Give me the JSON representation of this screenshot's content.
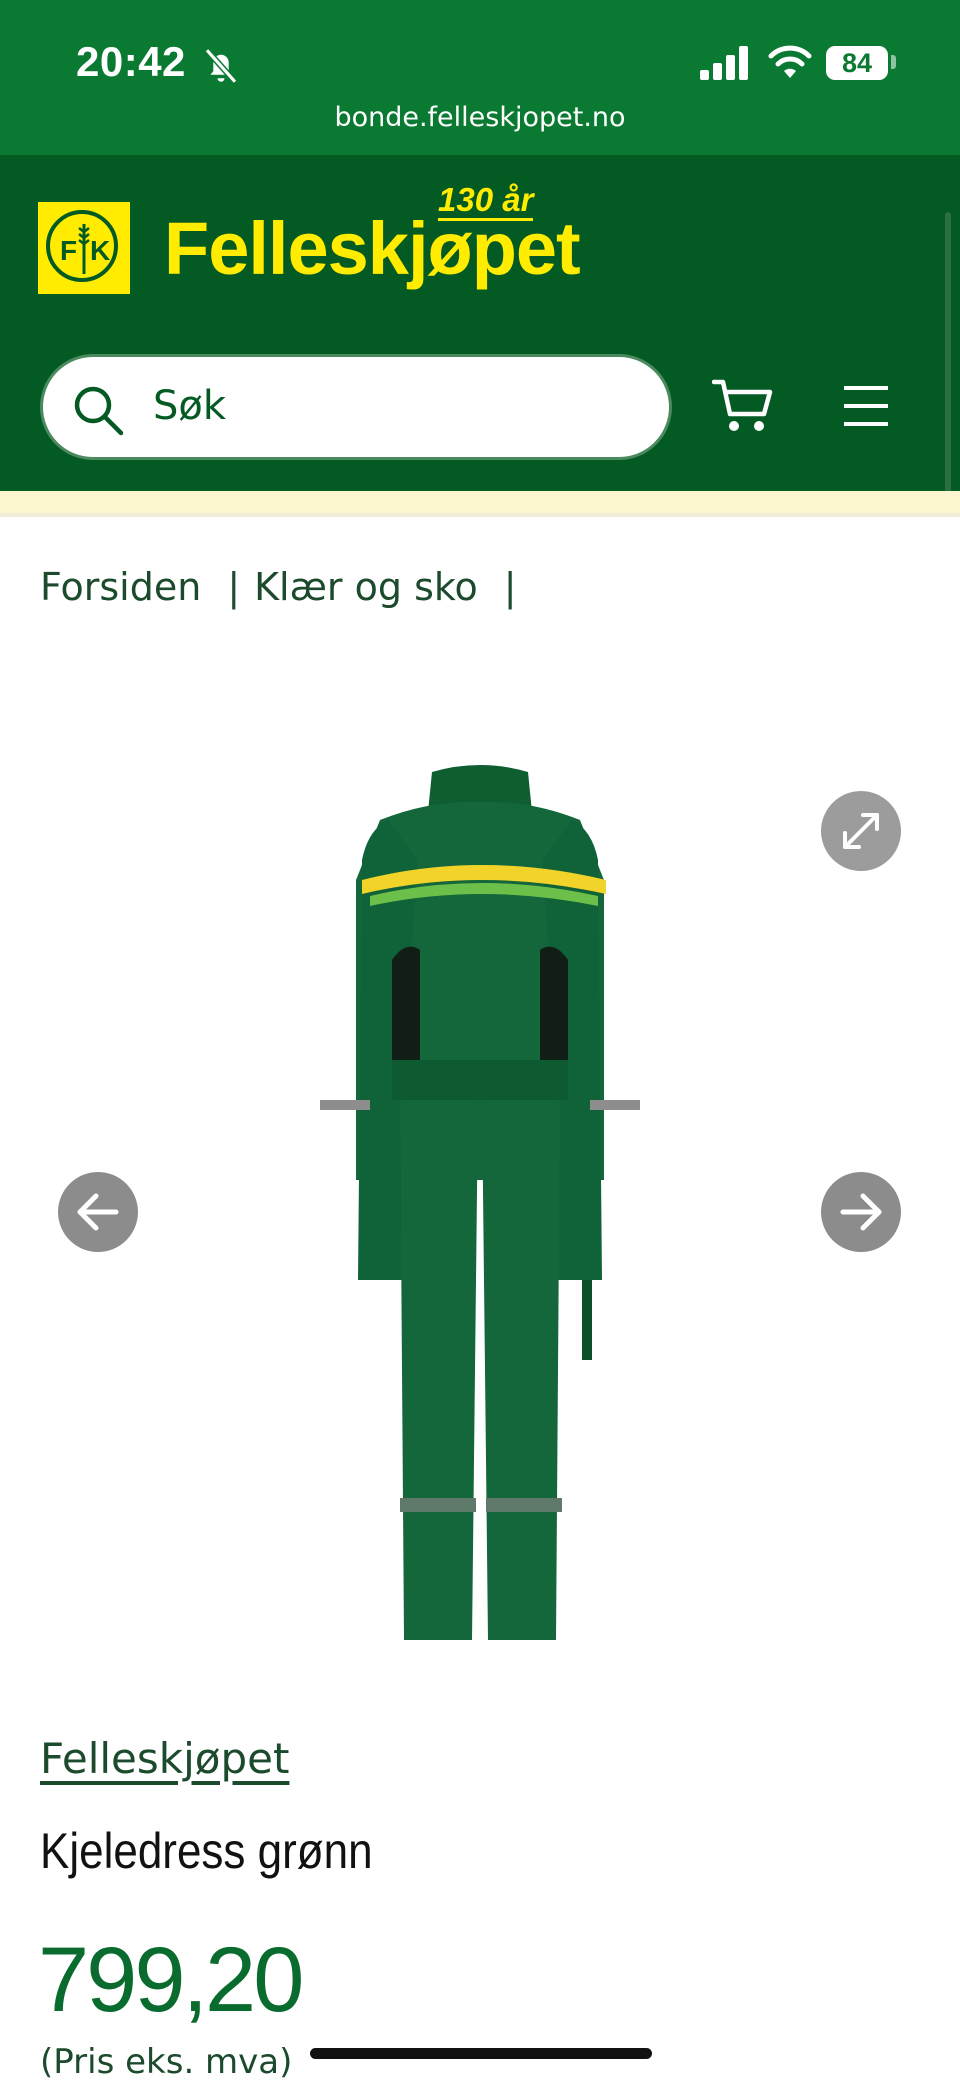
{
  "status_bar": {
    "time": "20:42",
    "battery": "84",
    "url": "bonde.felleskjopet.no"
  },
  "header": {
    "logo_badge": "FK",
    "logo_text": "Felleskjøpet",
    "anniversary": "130 år",
    "search_placeholder": "Søk",
    "colors": {
      "header_bg": "#045a23",
      "brand_yellow": "#ffec00",
      "status_bg": "#0a7a32"
    }
  },
  "breadcrumb": {
    "items": [
      "Forsiden",
      "Klær og sko"
    ],
    "separator": "|"
  },
  "product": {
    "brand": "Felleskjøpet",
    "title": "Kjeledress grønn",
    "price": "799,20",
    "price_note": "(Pris eks. mva)"
  },
  "icons": [
    "bell-off-icon",
    "signal-icon",
    "wifi-icon",
    "search-icon",
    "cart-icon",
    "menu-icon",
    "expand-icon",
    "arrow-left-icon",
    "arrow-right-icon"
  ]
}
